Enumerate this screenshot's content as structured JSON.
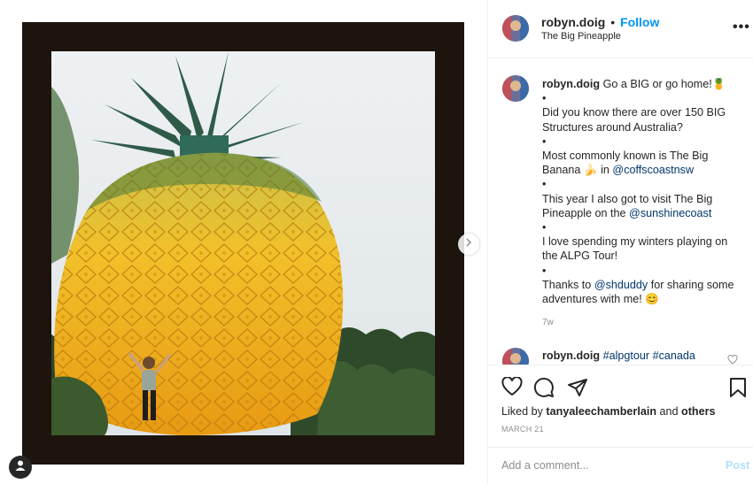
{
  "post": {
    "username": "robyn.doig",
    "follow_label": "Follow",
    "location": "The Big Pineapple",
    "more_label": "•••"
  },
  "caption": {
    "username": "robyn.doig",
    "line1": "Go a BIG or go home!",
    "emoji1": "🍍",
    "bullet": "•",
    "p2": "Did you know there are over 150 BIG Structures around Australia?",
    "p3_text": "Most commonly known is The Big Banana",
    "p3_emoji": "🍌",
    "p3_in": "in",
    "p3_link": "@coffscoastnsw",
    "p4_text": "This year I also got to visit The Big Pineapple on the",
    "p4_link": "@sunshinecoast",
    "p5": "I love spending my winters playing on the ALPG Tour!",
    "p6_pre": "Thanks to",
    "p6_link": "@shduddy",
    "p6_post": "for sharing some adventures with me!",
    "p6_emoji": "😊",
    "time": "7w"
  },
  "second_comment": {
    "username": "robyn.doig",
    "tags": "#alpgtour #canada"
  },
  "likes": {
    "prefix": "Liked by",
    "user": "tanyaleechamberlain",
    "and": "and",
    "others": "others"
  },
  "date": "MARCH 21",
  "add_comment": {
    "placeholder": "Add a comment...",
    "post_label": "Post",
    "post_color": "#b2dffc"
  },
  "colors": {
    "follow": "#0095f6",
    "link": "#00376b",
    "muted": "#8e8e8e",
    "frame": "#1c140d"
  },
  "icons": {
    "like": "heart-icon",
    "comment": "comment-icon",
    "share": "share-icon",
    "save": "bookmark-icon",
    "carousel_next": "chevron-right-icon",
    "profile": "profile-icon",
    "comment_like": "small-heart-icon"
  }
}
